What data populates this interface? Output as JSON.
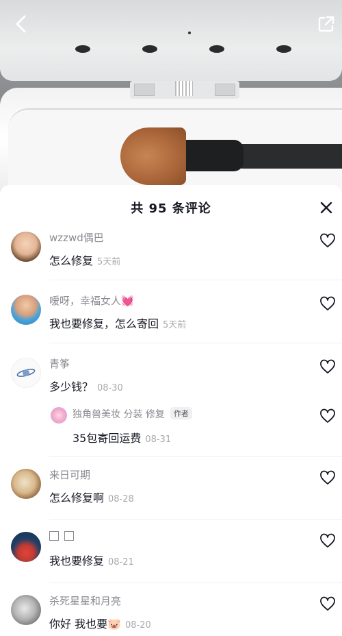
{
  "header": {
    "back_icon": "chevron-left-icon",
    "share_icon": "share-icon"
  },
  "sheet": {
    "title": "共 95 条评论",
    "close_icon": "close-icon"
  },
  "comments": [
    {
      "user": "wzzwd偶巴",
      "text": "怎么修复",
      "time": "5天前"
    },
    {
      "user": "嗳呀，幸福女人💓",
      "text": "我也要修复，怎么寄回",
      "time": "5天前"
    },
    {
      "user": "青筝",
      "text": "多少钱？",
      "time": "08-30"
    },
    {
      "user": "独角兽美妆 分装 修复",
      "badge": "作者",
      "text": "35包寄回运费",
      "time": "08-31"
    },
    {
      "user": "来日可期",
      "text": "怎么修复啊",
      "time": "08-28"
    },
    {
      "user": "",
      "text": "我也要修复",
      "time": "08-21"
    },
    {
      "user": "杀死星星和月亮",
      "text": "你好 我也要🐷",
      "time": "08-20"
    }
  ],
  "colors": {
    "primary_text": "#161823",
    "secondary_text": "#8a8b91",
    "heart_outline": "#161823"
  }
}
